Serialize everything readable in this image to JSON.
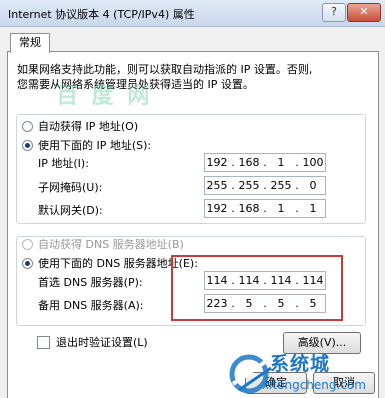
{
  "window": {
    "title": "Internet 协议版本 4 (TCP/IPv4) 属性",
    "help_label": "?",
    "close_label": "✕"
  },
  "tab": {
    "label": "常规"
  },
  "description": {
    "line1": "如果网络支持此功能，则可以获取自动指派的 IP 设置。否则,",
    "line2": "您需要从网络系统管理员处获得适当的 IP 设置。"
  },
  "watermark": "百 度 网",
  "ip_group": {
    "auto_label": "自动获得 IP 地址(O)",
    "manual_label": "使用下面的 IP 地址(S):",
    "selected": "manual",
    "fields": [
      {
        "label": "IP 地址(I):",
        "octets": [
          "192",
          "168",
          "1",
          "100"
        ]
      },
      {
        "label": "子网掩码(U):",
        "octets": [
          "255",
          "255",
          "255",
          "0"
        ]
      },
      {
        "label": "默认网关(D):",
        "octets": [
          "192",
          "168",
          "1",
          "1"
        ]
      }
    ]
  },
  "dns_group": {
    "auto_label": "自动获得 DNS 服务器地址(B)",
    "manual_label": "使用下面的 DNS 服务器地址(E):",
    "selected": "manual",
    "fields": [
      {
        "label": "首选 DNS 服务器(P):",
        "octets": [
          "114",
          "114",
          "114",
          "114"
        ]
      },
      {
        "label": "备用 DNS 服务器(A):",
        "octets": [
          "223",
          "5",
          "5",
          "5"
        ]
      }
    ]
  },
  "validate_checkbox": {
    "label": "退出时验证设置(L)",
    "checked": false
  },
  "buttons": {
    "advanced": "高级(V)...",
    "ok": "确定",
    "cancel": "取消"
  },
  "logo": {
    "text": "系统城",
    "sub": "xitongcheng.com"
  },
  "colors": {
    "highlight_box": "#c8393a",
    "logo": "#1e77c6"
  }
}
